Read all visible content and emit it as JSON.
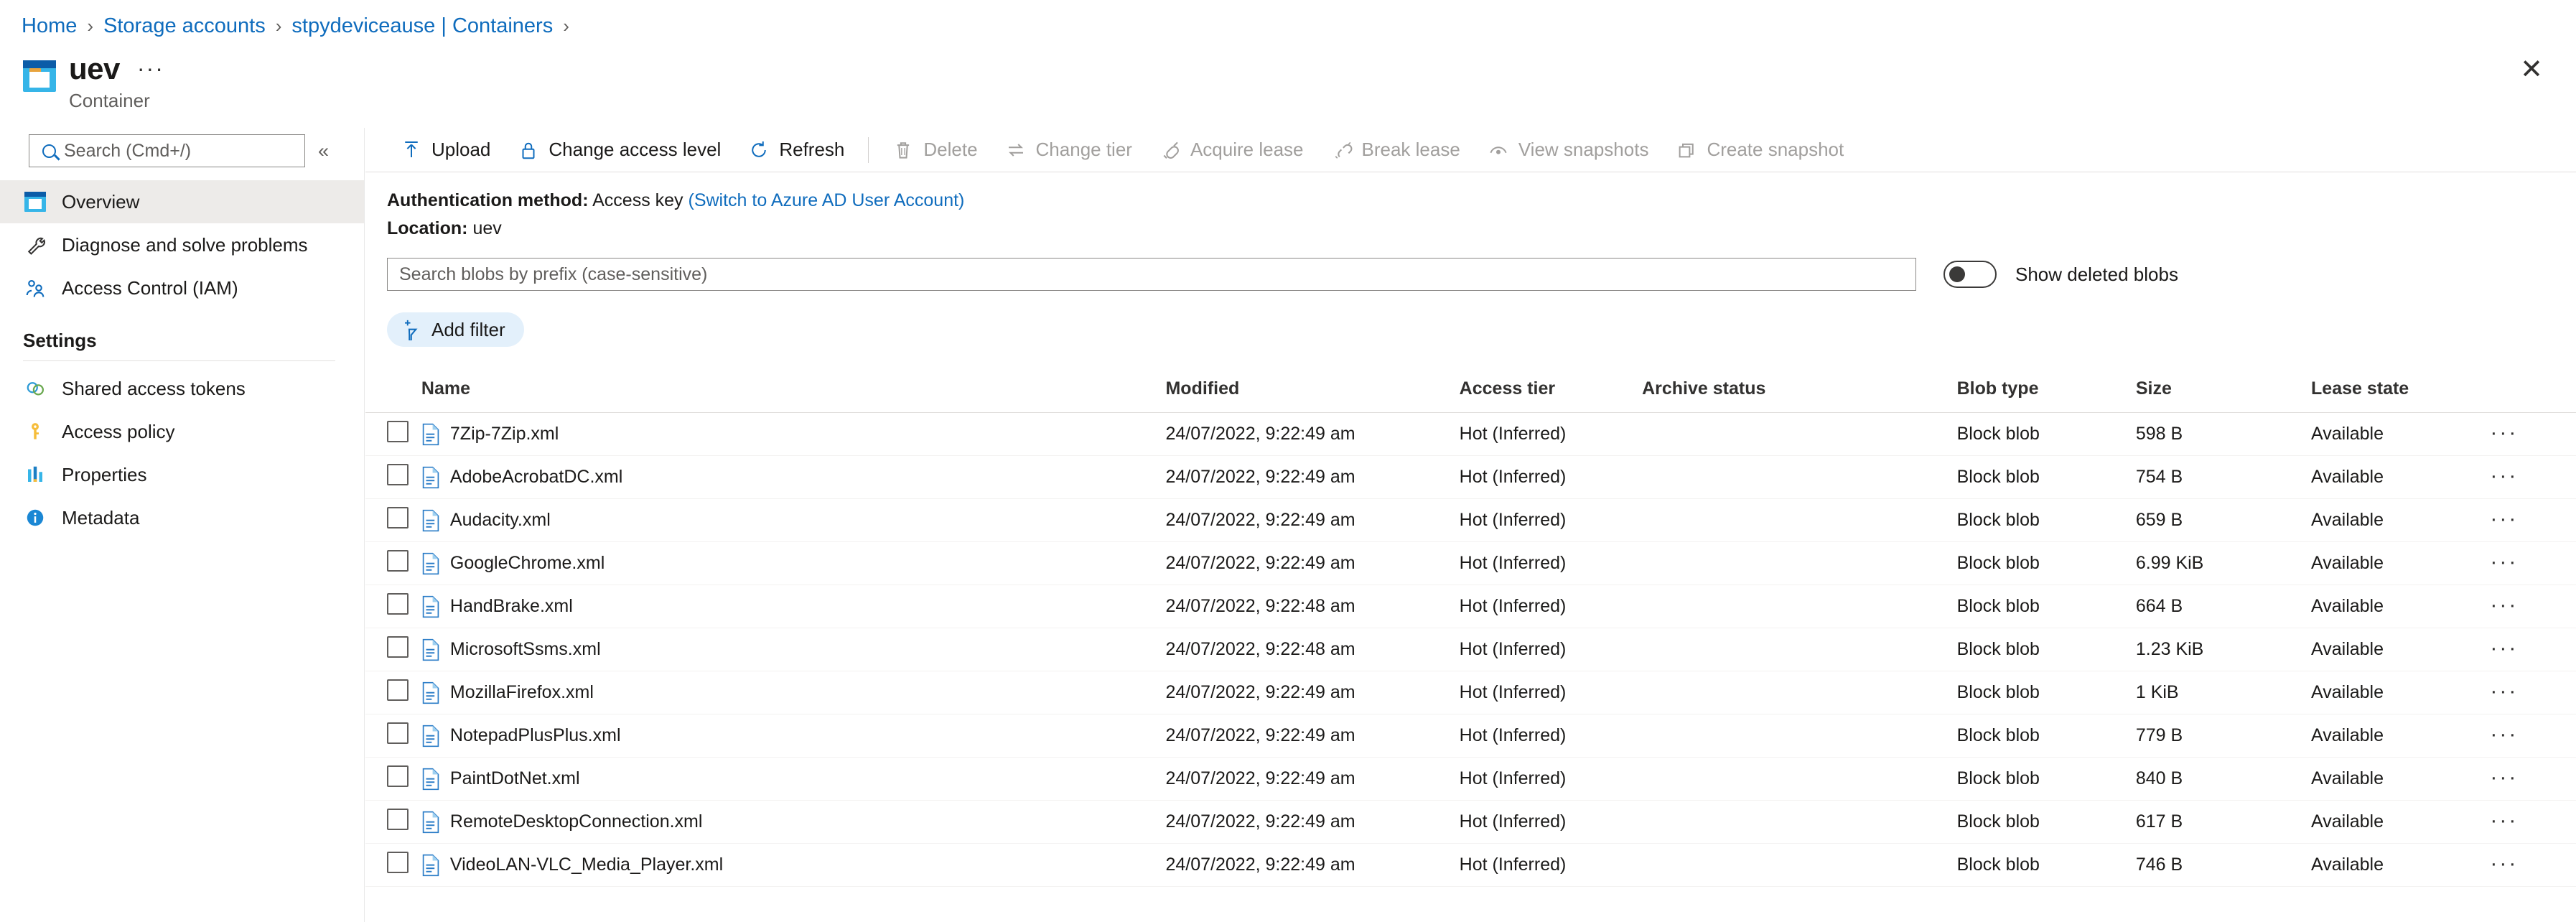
{
  "breadcrumb": {
    "items": [
      "Home",
      "Storage accounts",
      "stpydeviceause | Containers"
    ],
    "separator": "›"
  },
  "header": {
    "title": "uev",
    "subtitle": "Container",
    "ellipsis": "···",
    "close": "✕",
    "icon": "container-icon"
  },
  "sidebar": {
    "search": {
      "value": "",
      "placeholder": "Search (Cmd+/)",
      "icon": "search-icon"
    },
    "collapse": "«",
    "items": [
      {
        "label": "Overview",
        "icon": "overview-icon",
        "selected": true
      },
      {
        "label": "Diagnose and solve problems",
        "icon": "wrench-icon",
        "selected": false
      },
      {
        "label": "Access Control (IAM)",
        "icon": "people-icon",
        "selected": false
      }
    ],
    "group_title": "Settings",
    "settings_items": [
      {
        "label": "Shared access tokens",
        "icon": "link-rings-icon"
      },
      {
        "label": "Access policy",
        "icon": "key-icon"
      },
      {
        "label": "Properties",
        "icon": "bars-icon"
      },
      {
        "label": "Metadata",
        "icon": "info-icon"
      }
    ]
  },
  "toolbar": {
    "buttons": [
      {
        "label": "Upload",
        "icon": "upload-icon",
        "disabled": false
      },
      {
        "label": "Change access level",
        "icon": "lock-icon",
        "disabled": false
      },
      {
        "label": "Refresh",
        "icon": "refresh-icon",
        "disabled": false
      },
      {
        "label": "Delete",
        "icon": "trash-icon",
        "disabled": true
      },
      {
        "label": "Change tier",
        "icon": "swap-arrows-icon",
        "disabled": true
      },
      {
        "label": "Acquire lease",
        "icon": "plug-icon",
        "disabled": true
      },
      {
        "label": "Break lease",
        "icon": "broken-plug-icon",
        "disabled": true
      },
      {
        "label": "View snapshots",
        "icon": "eye-icon",
        "disabled": true
      },
      {
        "label": "Create snapshot",
        "icon": "copy-icon",
        "disabled": true
      }
    ]
  },
  "info": {
    "auth_label": "Authentication method:",
    "auth_value": "Access key",
    "auth_link": "(Switch to Azure AD User Account)",
    "location_label": "Location:",
    "location_value": "uev"
  },
  "blob_search": {
    "value": "",
    "placeholder": "Search blobs by prefix (case-sensitive)",
    "toggle_label": "Show deleted blobs",
    "toggle_on": false
  },
  "filter": {
    "label": "Add filter",
    "icon": "add-filter-icon"
  },
  "table": {
    "columns": [
      "Name",
      "Modified",
      "Access tier",
      "Archive status",
      "Blob type",
      "Size",
      "Lease state"
    ],
    "row_menu": "···",
    "rows": [
      {
        "name": "7Zip-7Zip.xml",
        "modified": "24/07/2022, 9:22:49 am",
        "tier": "Hot (Inferred)",
        "archive": "",
        "type": "Block blob",
        "size": "598 B",
        "lease": "Available"
      },
      {
        "name": "AdobeAcrobatDC.xml",
        "modified": "24/07/2022, 9:22:49 am",
        "tier": "Hot (Inferred)",
        "archive": "",
        "type": "Block blob",
        "size": "754 B",
        "lease": "Available"
      },
      {
        "name": "Audacity.xml",
        "modified": "24/07/2022, 9:22:49 am",
        "tier": "Hot (Inferred)",
        "archive": "",
        "type": "Block blob",
        "size": "659 B",
        "lease": "Available"
      },
      {
        "name": "GoogleChrome.xml",
        "modified": "24/07/2022, 9:22:49 am",
        "tier": "Hot (Inferred)",
        "archive": "",
        "type": "Block blob",
        "size": "6.99 KiB",
        "lease": "Available"
      },
      {
        "name": "HandBrake.xml",
        "modified": "24/07/2022, 9:22:48 am",
        "tier": "Hot (Inferred)",
        "archive": "",
        "type": "Block blob",
        "size": "664 B",
        "lease": "Available"
      },
      {
        "name": "MicrosoftSsms.xml",
        "modified": "24/07/2022, 9:22:48 am",
        "tier": "Hot (Inferred)",
        "archive": "",
        "type": "Block blob",
        "size": "1.23 KiB",
        "lease": "Available"
      },
      {
        "name": "MozillaFirefox.xml",
        "modified": "24/07/2022, 9:22:49 am",
        "tier": "Hot (Inferred)",
        "archive": "",
        "type": "Block blob",
        "size": "1 KiB",
        "lease": "Available"
      },
      {
        "name": "NotepadPlusPlus.xml",
        "modified": "24/07/2022, 9:22:49 am",
        "tier": "Hot (Inferred)",
        "archive": "",
        "type": "Block blob",
        "size": "779 B",
        "lease": "Available"
      },
      {
        "name": "PaintDotNet.xml",
        "modified": "24/07/2022, 9:22:49 am",
        "tier": "Hot (Inferred)",
        "archive": "",
        "type": "Block blob",
        "size": "840 B",
        "lease": "Available"
      },
      {
        "name": "RemoteDesktopConnection.xml",
        "modified": "24/07/2022, 9:22:49 am",
        "tier": "Hot (Inferred)",
        "archive": "",
        "type": "Block blob",
        "size": "617 B",
        "lease": "Available"
      },
      {
        "name": "VideoLAN-VLC_Media_Player.xml",
        "modified": "24/07/2022, 9:22:49 am",
        "tier": "Hot (Inferred)",
        "archive": "",
        "type": "Block blob",
        "size": "746 B",
        "lease": "Available"
      }
    ]
  },
  "colors": {
    "accent": "#0f6cbd",
    "selected_bg": "#edebe9",
    "disabled": "#a19f9d"
  }
}
